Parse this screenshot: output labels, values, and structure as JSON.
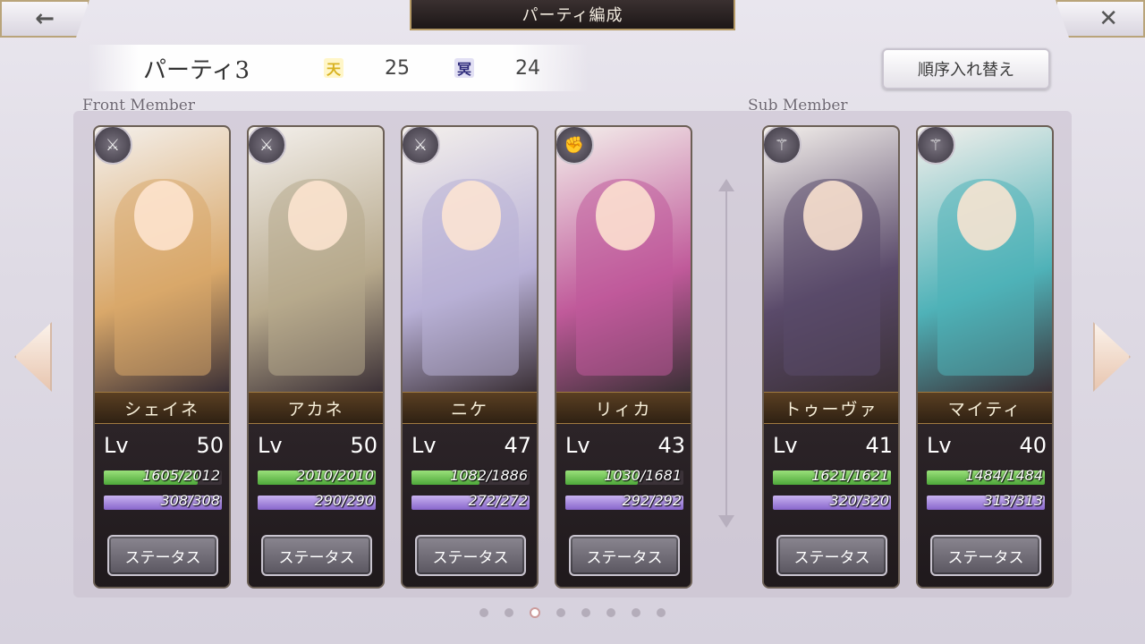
{
  "header": {
    "title": "パーティ編成",
    "back_icon": "←",
    "close_icon": "✕",
    "party_name": "パーティ3",
    "heaven_label": "天",
    "heaven_count": "25",
    "underworld_label": "冥",
    "underworld_count": "24",
    "reorder_label": "順序入れ替え"
  },
  "sections": {
    "front_label": "Front Member",
    "sub_label": "Sub Member"
  },
  "members": [
    {
      "name": "シェイネ",
      "lv_label": "Lv",
      "lv": "50",
      "hp": "1605/2012",
      "hp_ratio": 0.797,
      "mp": "308/308",
      "mp_ratio": 1.0,
      "status_label": "ステータス",
      "weapon_icon": "sword-icon",
      "color": "#d9a86a"
    },
    {
      "name": "アカネ",
      "lv_label": "Lv",
      "lv": "50",
      "hp": "2010/2010",
      "hp_ratio": 1.0,
      "mp": "290/290",
      "mp_ratio": 1.0,
      "status_label": "ステータス",
      "weapon_icon": "sword-icon",
      "color": "#b7a98c"
    },
    {
      "name": "ニケ",
      "lv_label": "Lv",
      "lv": "47",
      "hp": "1082/1886",
      "hp_ratio": 0.574,
      "mp": "272/272",
      "mp_ratio": 1.0,
      "status_label": "ステータス",
      "weapon_icon": "sword-icon",
      "color": "#b8b0d6"
    },
    {
      "name": "リィカ",
      "lv_label": "Lv",
      "lv": "43",
      "hp": "1030/1681",
      "hp_ratio": 0.613,
      "mp": "292/292",
      "mp_ratio": 1.0,
      "status_label": "ステータス",
      "weapon_icon": "gauntlet-icon",
      "color": "#c05a9a"
    },
    {
      "name": "トゥーヴァ",
      "lv_label": "Lv",
      "lv": "41",
      "hp": "1621/1621",
      "hp_ratio": 1.0,
      "mp": "320/320",
      "mp_ratio": 1.0,
      "status_label": "ステータス",
      "weapon_icon": "staff-icon",
      "color": "#5a4a6a"
    },
    {
      "name": "マイティ",
      "lv_label": "Lv",
      "lv": "40",
      "hp": "1484/1484",
      "hp_ratio": 1.0,
      "mp": "313/313",
      "mp_ratio": 1.0,
      "status_label": "ステータス",
      "weapon_icon": "staff-icon",
      "color": "#4fb2b8"
    }
  ],
  "pagination": {
    "count": 8,
    "active_index": 2
  },
  "colors": {
    "hp_bar": "#6cc24a",
    "mp_bar": "#9a7ad6",
    "gold_trim": "#b59a66"
  }
}
